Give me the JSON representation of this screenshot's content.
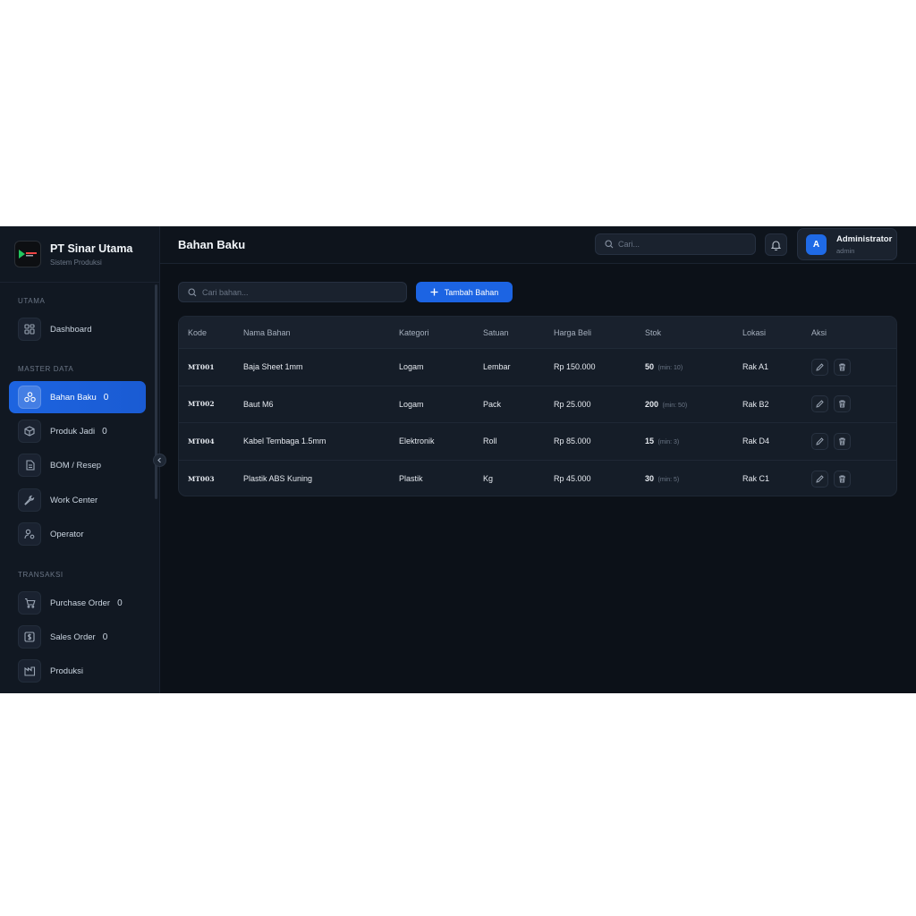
{
  "brand": {
    "name": "PT Sinar Utama",
    "subtitle": "Sistem Produksi"
  },
  "sidebar": {
    "sections": [
      {
        "label": "UTAMA"
      },
      {
        "label": "MASTER DATA"
      },
      {
        "label": "TRANSAKSI"
      }
    ],
    "items": [
      {
        "label": "Dashboard",
        "icon": "grid-icon",
        "badge": ""
      },
      {
        "label": "Bahan Baku",
        "icon": "cubes-icon",
        "badge": "0",
        "active": true
      },
      {
        "label": "Produk Jadi",
        "icon": "box-icon",
        "badge": "0"
      },
      {
        "label": "BOM / Resep",
        "icon": "document-icon",
        "badge": ""
      },
      {
        "label": "Work Center",
        "icon": "wrench-icon",
        "badge": ""
      },
      {
        "label": "Operator",
        "icon": "user-gear-icon",
        "badge": ""
      },
      {
        "label": "Purchase Order",
        "icon": "cart-icon",
        "badge": "0"
      },
      {
        "label": "Sales Order",
        "icon": "dollar-icon",
        "badge": "0"
      },
      {
        "label": "Produksi",
        "icon": "factory-icon",
        "badge": ""
      }
    ]
  },
  "header": {
    "title": "Bahan Baku",
    "search_placeholder": "Cari...",
    "user": {
      "initial": "A",
      "name": "Administrator",
      "role": "admin"
    }
  },
  "toolbar": {
    "search_placeholder": "Cari bahan...",
    "add_label": "Tambah Bahan"
  },
  "table": {
    "columns": [
      "Kode",
      "Nama Bahan",
      "Kategori",
      "Satuan",
      "Harga Beli",
      "Stok",
      "Lokasi",
      "Aksi"
    ],
    "rows": [
      {
        "kode": "MT001",
        "nama": "Baja Sheet 1mm",
        "kategori": "Logam",
        "satuan": "Lembar",
        "harga": "Rp 150.000",
        "stok": "50",
        "min": "(min: 10)",
        "lokasi": "Rak A1"
      },
      {
        "kode": "MT002",
        "nama": "Baut M6",
        "kategori": "Logam",
        "satuan": "Pack",
        "harga": "Rp 25.000",
        "stok": "200",
        "min": "(min: 50)",
        "lokasi": "Rak B2"
      },
      {
        "kode": "MT004",
        "nama": "Kabel Tembaga 1.5mm",
        "kategori": "Elektronik",
        "satuan": "Roll",
        "harga": "Rp 85.000",
        "stok": "15",
        "min": "(min: 3)",
        "lokasi": "Rak D4"
      },
      {
        "kode": "MT003",
        "nama": "Plastik ABS Kuning",
        "kategori": "Plastik",
        "satuan": "Kg",
        "harga": "Rp 45.000",
        "stok": "30",
        "min": "(min: 5)",
        "lokasi": "Rak C1"
      }
    ]
  },
  "colors": {
    "accent": "#1c64e3",
    "background": "#0c1118",
    "sidebar": "#111822"
  }
}
